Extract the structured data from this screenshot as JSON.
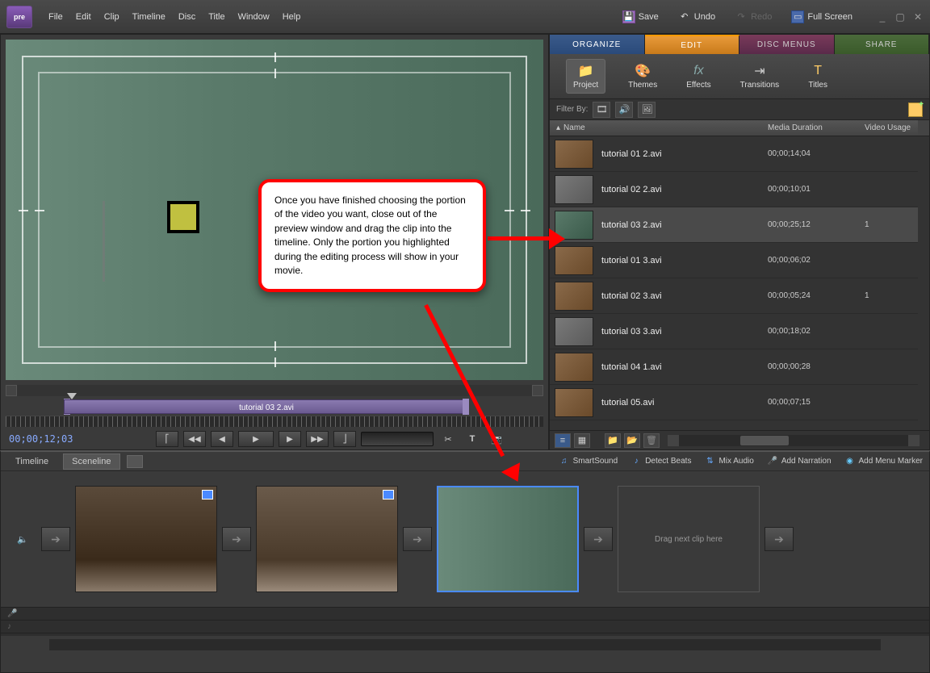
{
  "app": {
    "logo": "pre"
  },
  "menu": [
    "File",
    "Edit",
    "Clip",
    "Timeline",
    "Disc",
    "Title",
    "Window",
    "Help"
  ],
  "toolbar": {
    "save": "Save",
    "undo": "Undo",
    "redo": "Redo",
    "fullscreen": "Full Screen"
  },
  "preview": {
    "trim_clip_label": "tutorial 03 2.avi",
    "timecode": "00;00;12;03"
  },
  "main_tabs": {
    "organize": "ORGANIZE",
    "edit": "EDIT",
    "disc": "DISC MENUS",
    "share": "SHARE"
  },
  "sub_tools": {
    "project": "Project",
    "themes": "Themes",
    "effects": "Effects",
    "transitions": "Transitions",
    "titles": "Titles"
  },
  "filter": {
    "label": "Filter By:"
  },
  "columns": {
    "name": "Name",
    "duration": "Media Duration",
    "usage": "Video Usage"
  },
  "clips": [
    {
      "name": "tutorial 01 2.avi",
      "duration": "00;00;14;04",
      "usage": "",
      "thumb": "th-brown"
    },
    {
      "name": "tutorial 02 2.avi",
      "duration": "00;00;10;01",
      "usage": "",
      "thumb": "th-grey"
    },
    {
      "name": "tutorial 03 2.avi",
      "duration": "00;00;25;12",
      "usage": "1",
      "thumb": "th-green",
      "selected": true
    },
    {
      "name": "tutorial 01 3.avi",
      "duration": "00;00;06;02",
      "usage": "",
      "thumb": "th-brown"
    },
    {
      "name": "tutorial 02 3.avi",
      "duration": "00;00;05;24",
      "usage": "1",
      "thumb": "th-brown"
    },
    {
      "name": "tutorial 03 3.avi",
      "duration": "00;00;18;02",
      "usage": "",
      "thumb": "th-grey"
    },
    {
      "name": "tutorial 04 1.avi",
      "duration": "00;00;00;28",
      "usage": "",
      "thumb": "th-brown"
    },
    {
      "name": "tutorial 05.avi",
      "duration": "00;00;07;15",
      "usage": "",
      "thumb": "th-brown"
    }
  ],
  "sceneline": {
    "tabs": {
      "timeline": "Timeline",
      "sceneline": "Sceneline"
    },
    "tools": {
      "smartsound": "SmartSound",
      "detect_beats": "Detect Beats",
      "mix_audio": "Mix Audio",
      "add_narration": "Add Narration",
      "add_marker": "Add Menu Marker"
    },
    "dropzone": "Drag next clip here"
  },
  "callout": {
    "text": "Once you have finished choosing the portion of the video you want, close out of the preview window and drag the clip into the timeline.  Only the portion you highlighted during the editing process will show in your movie."
  }
}
